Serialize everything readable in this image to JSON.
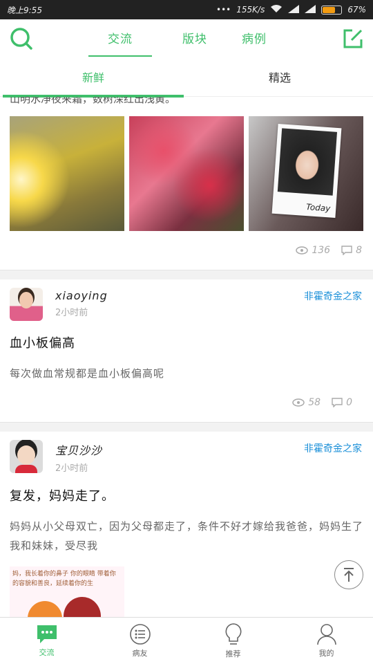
{
  "status_bar": {
    "time": "晚上9:55",
    "network_speed": "155K/s",
    "battery": "67%",
    "battery_level": 0.67
  },
  "header": {
    "tabs": [
      {
        "label": "交流",
        "active": true
      },
      {
        "label": "版块",
        "active": false
      },
      {
        "label": "病例",
        "active": false
      }
    ],
    "icons": [
      "search-icon",
      "compose-icon"
    ]
  },
  "subtabs": [
    {
      "label": "新鲜",
      "active": true
    },
    {
      "label": "精选",
      "active": false
    }
  ],
  "colors": {
    "accent": "#3fbf6b",
    "forum_link": "#1a8fd8"
  },
  "feed": {
    "partial_post": {
      "text_cut": "山明水净夜来霜，数树深红出浅黄。",
      "photo_caption": "Today",
      "views": "136",
      "comments": "8"
    },
    "posts": [
      {
        "author": "xiaoying",
        "time": "2小时前",
        "forum": "非霍奇金之家",
        "title": "血小板偏高",
        "body": "每次做血常规都是血小板偏高呢",
        "views": "58",
        "comments": "0"
      },
      {
        "author": "宝贝沙沙",
        "time": "2小时前",
        "forum": "非霍奇金之家",
        "title": "复发，妈妈走了。",
        "body": "妈妈从小父母双亡，因为父母都走了，条件不好才嫁给我爸爸，妈妈生了我和妹妹，受尽我",
        "image_text": "妈，我长着你的鼻子 你的眼睛 带着你的容貌和善良，延续着你的生"
      }
    ]
  },
  "bottom_nav": [
    {
      "label": "交流",
      "icon": "chat-icon",
      "active": true
    },
    {
      "label": "病友",
      "icon": "list-icon",
      "active": false
    },
    {
      "label": "推荐",
      "icon": "bulb-icon",
      "active": false
    },
    {
      "label": "我的",
      "icon": "person-icon",
      "active": false
    }
  ]
}
